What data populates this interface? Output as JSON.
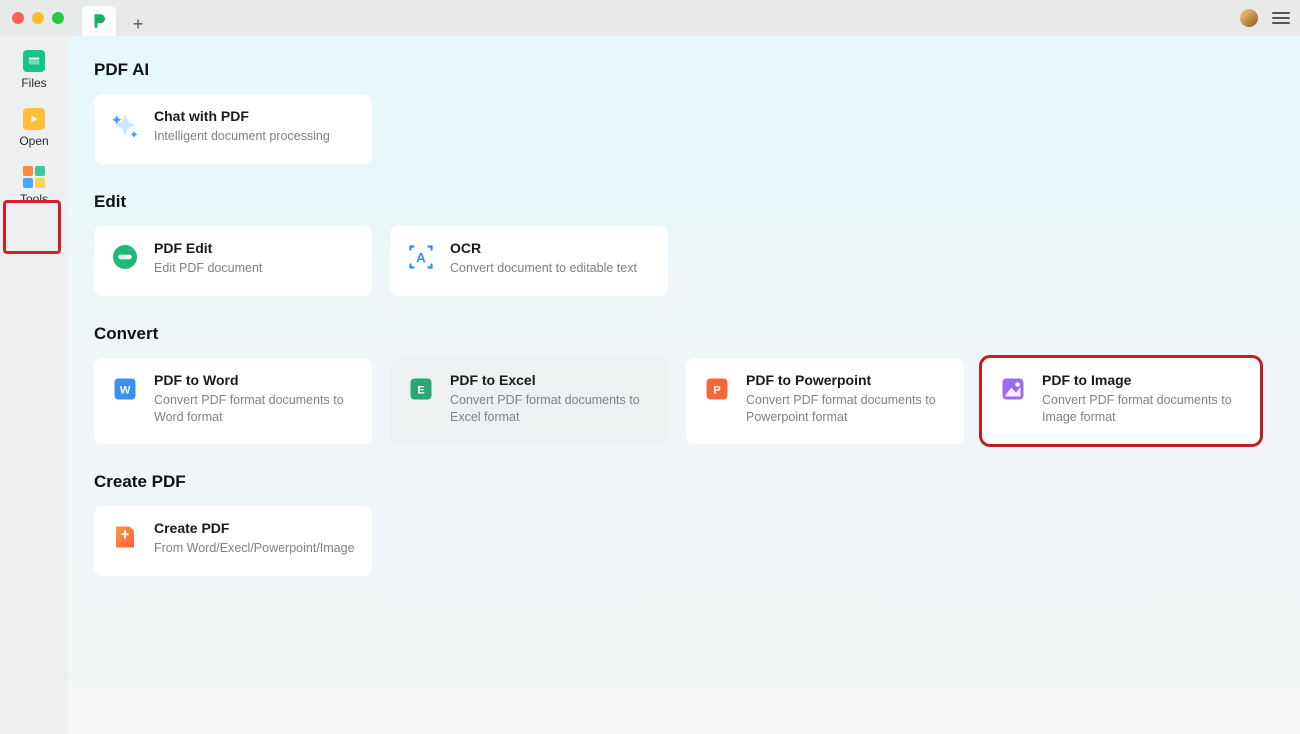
{
  "titlebar": {
    "add_tab": "+"
  },
  "sidebar": {
    "items": [
      {
        "label": "Files"
      },
      {
        "label": "Open"
      },
      {
        "label": "Tools"
      }
    ]
  },
  "sections": {
    "pdf_ai": {
      "heading": "PDF AI",
      "cards": {
        "chat": {
          "title": "Chat with PDF",
          "desc": "Intelligent document processing"
        }
      }
    },
    "edit": {
      "heading": "Edit",
      "cards": {
        "pdf_edit": {
          "title": "PDF Edit",
          "desc": "Edit PDF document"
        },
        "ocr": {
          "title": "OCR",
          "desc": "Convert document to editable text"
        }
      }
    },
    "convert": {
      "heading": "Convert",
      "cards": {
        "word": {
          "title": "PDF to Word",
          "desc": "Convert PDF format documents to Word format"
        },
        "excel": {
          "title": "PDF to Excel",
          "desc": "Convert PDF format documents to Excel format"
        },
        "ppt": {
          "title": "PDF to Powerpoint",
          "desc": "Convert PDF format documents to Powerpoint format"
        },
        "image": {
          "title": "PDF to Image",
          "desc": "Convert PDF format documents to Image format"
        }
      }
    },
    "create": {
      "heading": "Create PDF",
      "cards": {
        "create": {
          "title": "Create PDF",
          "desc": "From Word/Execl/Powerpoint/Image"
        }
      }
    }
  }
}
